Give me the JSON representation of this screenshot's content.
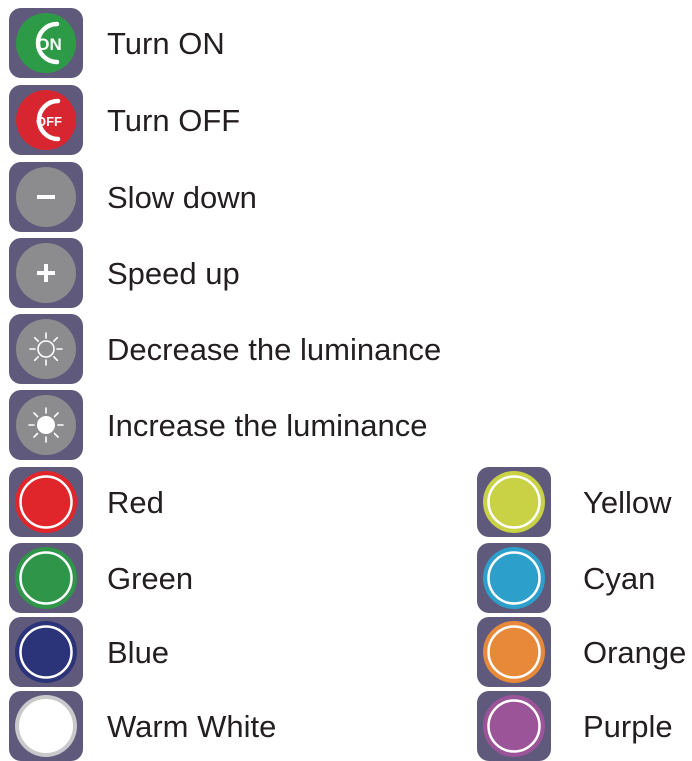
{
  "commands": [
    {
      "id": "turn-on",
      "label": "Turn ON",
      "icon": "power-on-icon",
      "color": "#2d9a47",
      "badge": "ON"
    },
    {
      "id": "turn-off",
      "label": "Turn OFF",
      "icon": "power-off-icon",
      "color": "#d7262f",
      "badge": "OFF"
    },
    {
      "id": "slow-down",
      "label": "Slow down",
      "icon": "minus-icon",
      "color": "#8c8c8e"
    },
    {
      "id": "speed-up",
      "label": "Speed up",
      "icon": "plus-icon",
      "color": "#8c8c8e"
    },
    {
      "id": "decrease-luminance",
      "label": "Decrease the luminance",
      "icon": "sun-outline-icon",
      "color": "#8c8c8e"
    },
    {
      "id": "increase-luminance",
      "label": "Increase the luminance",
      "icon": "sun-filled-icon",
      "color": "#8c8c8e"
    }
  ],
  "colors_left": [
    {
      "label": "Red",
      "icon": "red-circle-icon",
      "color": "#e0262b"
    },
    {
      "label": "Green",
      "icon": "green-circle-icon",
      "color": "#2f9548"
    },
    {
      "label": "Blue",
      "icon": "blue-circle-icon",
      "color": "#2b3479"
    },
    {
      "label": "Warm White",
      "icon": "warm-white-circle-icon",
      "color": "#ffffff"
    }
  ],
  "colors_right": [
    {
      "label": "Yellow",
      "icon": "yellow-circle-icon",
      "color": "#c9d245"
    },
    {
      "label": "Cyan",
      "icon": "cyan-circle-icon",
      "color": "#2d9fcb"
    },
    {
      "label": "Orange",
      "icon": "orange-circle-icon",
      "color": "#e8893a"
    },
    {
      "label": "Purple",
      "icon": "purple-circle-icon",
      "color": "#9b5497"
    }
  ]
}
